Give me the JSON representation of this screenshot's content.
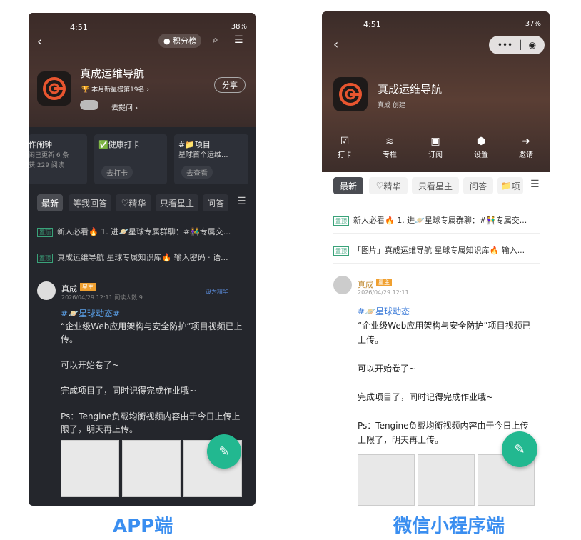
{
  "left": {
    "status": {
      "time": "4:51",
      "right": "38%"
    },
    "ranking_label": "积分榜",
    "title": "真成运维导航",
    "badge": "本月新星榜第19名",
    "ask_label": "去提问",
    "share_label": "分享",
    "cards": [
      {
        "title": "作闹钟",
        "line1": "闹已更新 6 条",
        "line2": "获 229 阅读"
      },
      {
        "title": "✅健康打卡",
        "button": "去打卡"
      },
      {
        "title": "#📁项目",
        "line1": "星球首个运维...",
        "button": "去查看"
      }
    ],
    "tabs": [
      "最新",
      "等我回答",
      "精华",
      "只看星主",
      "问答"
    ],
    "pinned": [
      "新人必看🔥 1. 进🪐星球专属群聊：#👫专属交...",
      "真成运维导航 星球专属知识库🔥 输入密码 · 语..."
    ],
    "pin_label": "置顶",
    "post": {
      "author": "真成",
      "role": "星主",
      "meta": "2026/04/29 12:11  阅读人数 9",
      "action": "设为精华",
      "topic": "#🪐星球动态#",
      "lines": [
        "“企业级Web应用架构与安全防护”项目视频已上传。",
        "可以开始卷了~",
        "完成项目了，同时记得完成作业哦~",
        "Ps：Tengine负载均衡视频内容由于今日上传上限了，明天再上传。"
      ]
    }
  },
  "right": {
    "status": {
      "time": "4:51",
      "right": "37%"
    },
    "title": "真成运维导航",
    "creator": "真成 创建",
    "icons": [
      "打卡",
      "专栏",
      "订阅",
      "设置",
      "邀请"
    ],
    "tabs": [
      "最新",
      "精华",
      "只看星主",
      "问答",
      "项"
    ],
    "pinned": [
      "新人必看🔥 1. 进🪐星球专属群聊：#👫专属交...",
      "「图片」真成运维导航 星球专属知识库🔥 输入..."
    ],
    "pin_label": "置顶",
    "post": {
      "author": "真成",
      "role": "星主",
      "meta": "2026/04/29 12:11",
      "topic": "#🪐星球动态",
      "lines": [
        "“企业级Web应用架构与安全防护”项目视频已上传。",
        "可以开始卷了~",
        "完成项目了，同时记得完成作业哦~",
        "Ps：Tengine负载均衡视频内容由于今日上传上限了，明天再上传。"
      ]
    }
  },
  "captions": {
    "left": "APP端",
    "right": "微信小程序端"
  },
  "colors": {
    "accent": "#22b890",
    "caption": "#3a8ef0",
    "brand": "#e8552f"
  }
}
